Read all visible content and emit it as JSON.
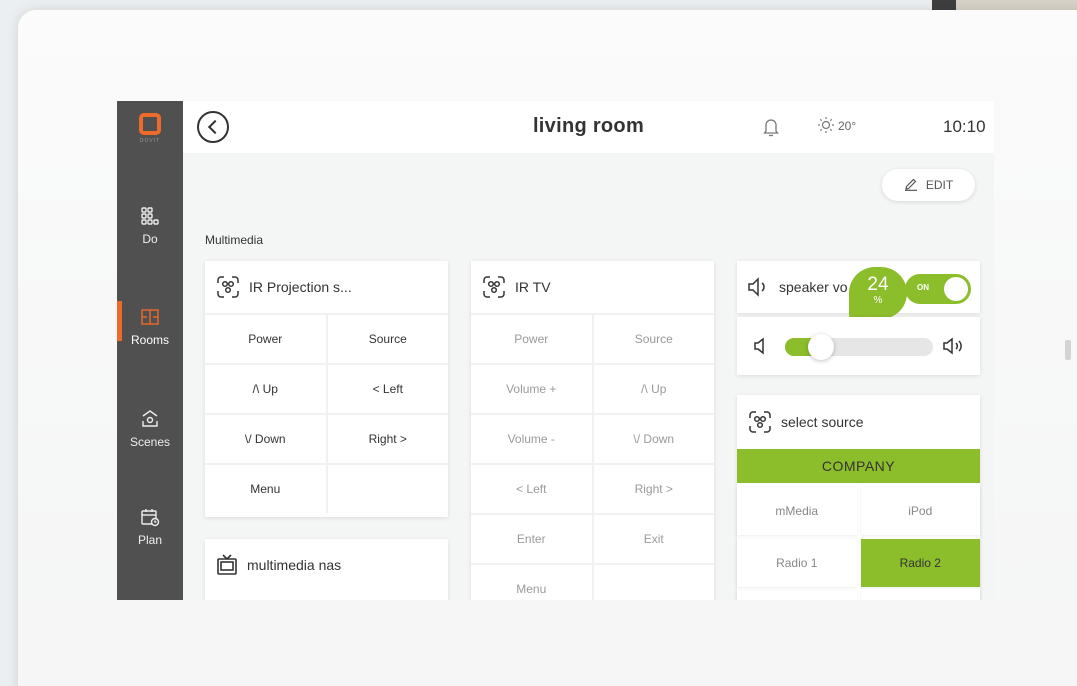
{
  "brand": {
    "logo_text": "DOVIT",
    "accent": "#ee6a2a",
    "green": "#8cbd2b"
  },
  "sidebar": {
    "items": [
      {
        "label": "Do",
        "icon": "grid-icon",
        "active": false
      },
      {
        "label": "Rooms",
        "icon": "rooms-icon",
        "active": true
      },
      {
        "label": "Scenes",
        "icon": "scenes-icon",
        "active": false
      },
      {
        "label": "Plan",
        "icon": "calendar-icon",
        "active": false
      }
    ]
  },
  "header": {
    "title": "living room",
    "temperature": "20°",
    "time": "10:10"
  },
  "edit_label": "EDIT",
  "section": "Multimedia",
  "ir_projection": {
    "title": "IR Projection s...",
    "buttons": [
      "Power",
      "Source",
      "/\\ Up",
      "< Left",
      "\\/ Down",
      "Right >",
      "Menu",
      ""
    ]
  },
  "ir_tv": {
    "title": "IR TV",
    "buttons": [
      "Power",
      "Source",
      "Volume +",
      "/\\ Up",
      "Volume -",
      "\\/ Down",
      "< Left",
      "Right >",
      "Enter",
      "Exit",
      "Menu",
      ""
    ]
  },
  "multimedia_nas": {
    "title": "multimedia nas"
  },
  "speaker": {
    "title": "speaker vo",
    "toggle_label": "ON",
    "volume_value": "24",
    "volume_unit": "%",
    "volume_level": 0.24
  },
  "select_source": {
    "title": "select source",
    "group": "COMPANY",
    "options": [
      "mMedia",
      "iPod",
      "Radio 1",
      "Radio 2"
    ],
    "selected": "Radio 2"
  }
}
